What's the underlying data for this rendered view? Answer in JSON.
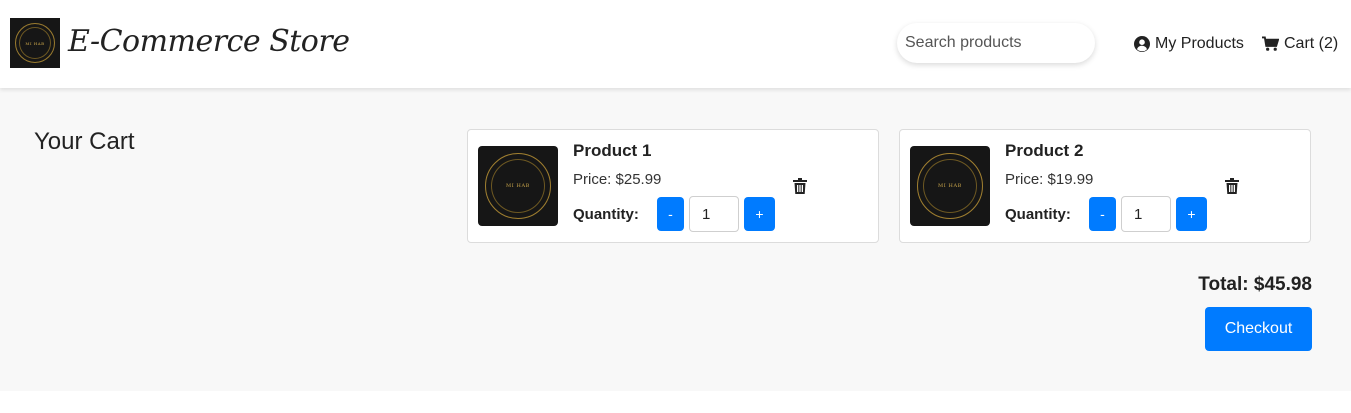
{
  "header": {
    "logo_text": "MI HAB",
    "title": "E-Commerce Store",
    "search_placeholder": "Search products",
    "my_products_label": "My Products",
    "cart_label": "Cart (2)",
    "my_products_icon": "user-circle-icon",
    "cart_icon": "shopping-cart-icon"
  },
  "cart": {
    "heading": "Your Cart",
    "items": [
      {
        "name": "Product 1",
        "price": "Price: $25.99",
        "quantity_label": "Quantity:",
        "quantity": "1",
        "minus": "-",
        "plus": "+",
        "thumb_text": "MI HAB"
      },
      {
        "name": "Product 2",
        "price": "Price: $19.99",
        "quantity_label": "Quantity:",
        "quantity": "1",
        "minus": "-",
        "plus": "+",
        "thumb_text": "MI HAB"
      }
    ],
    "total": "Total: $45.98",
    "checkout_label": "Checkout"
  },
  "colors": {
    "primary": "#007bff",
    "page_bg": "#f8f8f8",
    "header_bg": "#ffffff",
    "text": "#222222"
  }
}
